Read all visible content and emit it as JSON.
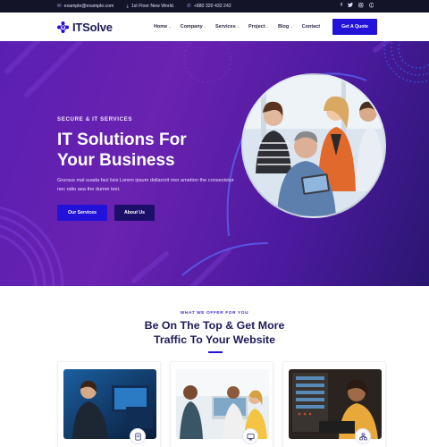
{
  "topbar": {
    "email": "example@example.com",
    "address": "1st Floor New World.",
    "phone": "+880 320 432 242",
    "email_icon": "envelope-icon",
    "address_icon": "download-icon",
    "phone_icon": "phone-icon",
    "social": [
      "facebook-icon",
      "twitter-icon",
      "instagram-icon",
      "pinterest-icon"
    ]
  },
  "nav": {
    "brand": "ITSolve",
    "menu": [
      {
        "label": "Home",
        "has_dropdown": true
      },
      {
        "label": "Company",
        "has_dropdown": true
      },
      {
        "label": "Services",
        "has_dropdown": true
      },
      {
        "label": "Project",
        "has_dropdown": true
      },
      {
        "label": "Blog",
        "has_dropdown": true
      },
      {
        "label": "Contact",
        "has_dropdown": false
      }
    ],
    "cta": "Get A Quote"
  },
  "hero": {
    "eyebrow": "SECURE & IT SERVICES",
    "title_line1": "IT Solutions For",
    "title_line2": "Your Business",
    "description": "Grursus mal suada faci lisis Lorem ipsum dollarorit mor ametion the consectetur nec odio aea the dumm text.",
    "primary_button": "Our Services",
    "secondary_button": "About Us"
  },
  "services": {
    "eyebrow": "WHAT WE OFFER FOR YOU",
    "title_line1": "Be On The Top & Get More",
    "title_line2": "Traffic To Your Website",
    "cards": [
      {
        "icon": "document-icon"
      },
      {
        "icon": "monitor-icon"
      },
      {
        "icon": "network-icon"
      }
    ]
  },
  "colors": {
    "accent": "#2211d9",
    "hero_start": "#5a1fb2",
    "hero_end": "#2a1670",
    "topbar": "#141428",
    "heading": "#1c1b5a"
  }
}
